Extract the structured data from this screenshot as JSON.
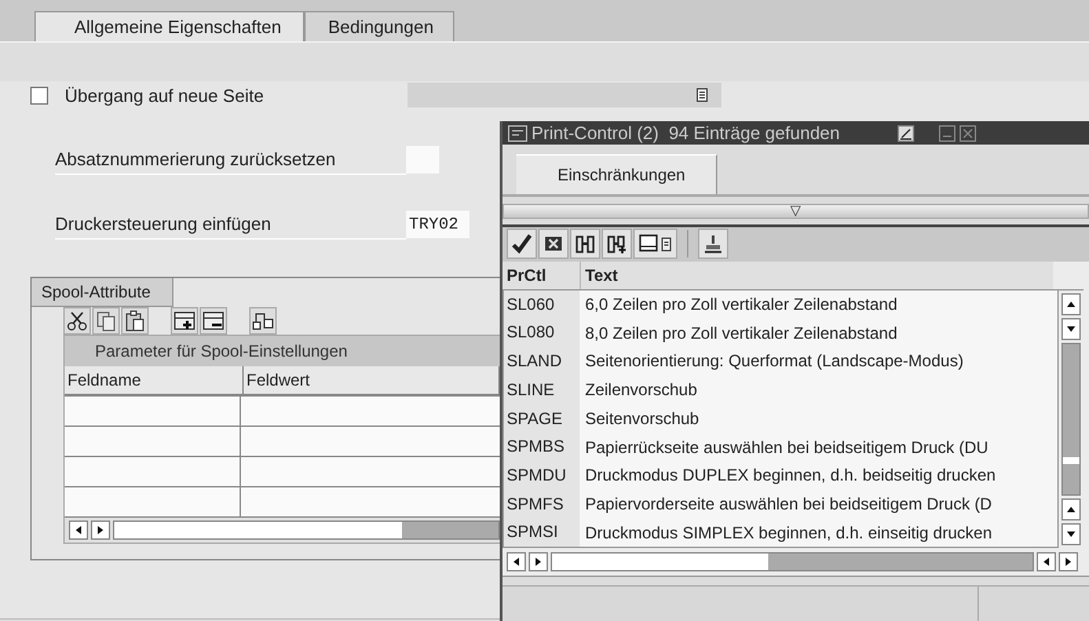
{
  "tabs": [
    {
      "label": "Allgemeine Eigenschaften",
      "selected": true
    },
    {
      "label": "Bedingungen",
      "selected": false
    }
  ],
  "fields": [
    {
      "kind": "checkbox",
      "label": "Übergang auf neue Seite",
      "checked": false
    },
    {
      "kind": "input",
      "label": "Absatznummerierung zurücksetzen"
    },
    {
      "kind": "input",
      "label": "Druckersteuerung einfügen",
      "value": "TRY02"
    }
  ],
  "spool_group": {
    "title": "Spool-Attribute",
    "grid": {
      "title": "Parameter für Spool-Einstellungen",
      "columns": [
        "Feldname",
        "Feldwert"
      ]
    }
  },
  "popup": {
    "title": "Print-Control (2)  94 Einträge gefunden",
    "tabs": [
      {
        "label": "Einschränkungen",
        "selected": true
      }
    ],
    "collapse_toggle": "▽",
    "table": {
      "columns": [
        "PrCtl",
        "Text"
      ],
      "rows": [
        {
          "code": "SL060",
          "text": "6,0 Zeilen pro Zoll vertikaler Zeilenabstand"
        },
        {
          "code": "SL080",
          "text": "8,0 Zeilen pro Zoll vertikaler Zeilenabstand"
        },
        {
          "code": "SLAND",
          "text": "Seitenorientierung: Querformat (Landscape-Modus)"
        },
        {
          "code": "SLINE",
          "text": "Zeilenvorschub"
        },
        {
          "code": "SPAGE",
          "text": "Seitenvorschub"
        },
        {
          "code": "SPMBS",
          "text": "Papierrückseite auswählen bei beidseitigem Druck (DU"
        },
        {
          "code": "SPMDU",
          "text": "Druckmodus DUPLEX beginnen, d.h. beidseitig drucken"
        },
        {
          "code": "SPMFS",
          "text": "Papiervorderseite auswählen bei beidseitigem Druck (D"
        },
        {
          "code": "SPMSI",
          "text": "Druckmodus SIMPLEX beginnen, d.h. einseitig drucken"
        }
      ]
    }
  }
}
